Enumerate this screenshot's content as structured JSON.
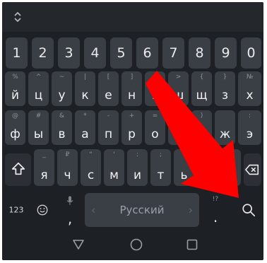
{
  "toolbar": {
    "expand_icon": "expand-collapse-icon"
  },
  "number_row": [
    "1",
    "2",
    "3",
    "4",
    "5",
    "6",
    "7",
    "8",
    "9",
    "0"
  ],
  "row1": {
    "keys": [
      "й",
      "ц",
      "у",
      "к",
      "е",
      "н",
      "г",
      "ш",
      "щ",
      "з",
      "х"
    ],
    "hints": [
      "%",
      "^",
      "~",
      "|",
      "[",
      "]",
      "<",
      ">",
      "{",
      "}",
      "№"
    ]
  },
  "row2": {
    "keys": [
      "ф",
      "ы",
      "в",
      "а",
      "п",
      "р",
      "о",
      "л",
      "д",
      "ж",
      "э"
    ],
    "hints": [
      "@",
      "#",
      "&",
      "*",
      "-",
      "+",
      "=",
      "(",
      ")",
      "",
      ":"
    ]
  },
  "row3": {
    "keys": [
      "я",
      "ч",
      "с",
      "м",
      "и",
      "т",
      "ь",
      "б",
      "ю"
    ],
    "hints": [
      "_",
      "₽",
      "\"",
      "'",
      ":",
      ";",
      "!",
      "?",
      "€"
    ]
  },
  "bottom_row": {
    "symbols_label": "123",
    "comma_label": ",",
    "space_label": "Русский",
    "period_label": ".",
    "period_hint": "!?"
  },
  "colors": {
    "key": "#3a3e45",
    "keyboard_bg": "#1d2024",
    "annotation_arrow": "#ff0000"
  }
}
